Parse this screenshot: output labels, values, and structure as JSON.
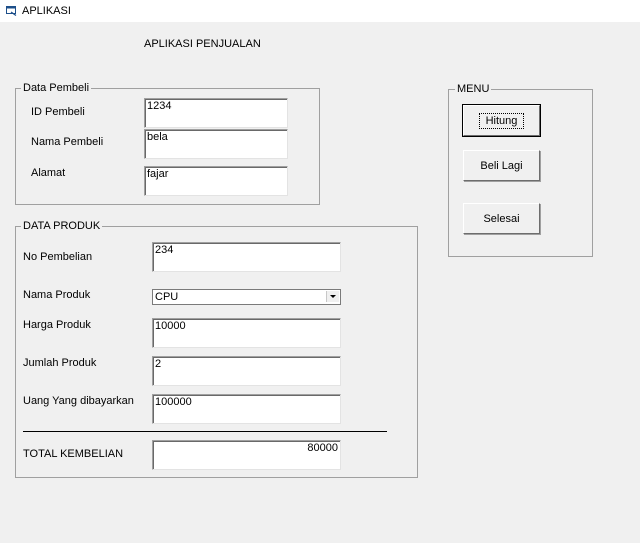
{
  "window": {
    "title": "APLIKASI"
  },
  "heading": "APLIKASI PENJUALAN",
  "data_pembeli": {
    "legend": "Data Pembeli",
    "id_label": "ID Pembeli",
    "id_value": "1234",
    "nama_label": "Nama Pembeli",
    "nama_value": "bela",
    "alamat_label": "Alamat",
    "alamat_value": "fajar"
  },
  "data_produk": {
    "legend": "DATA PRODUK",
    "no_label": "No Pembelian",
    "no_value": "234",
    "produk_label": "Nama Produk",
    "produk_value": "CPU",
    "harga_label": "Harga Produk",
    "harga_value": "10000",
    "jumlah_label": "Jumlah Produk",
    "jumlah_value": "2",
    "uang_label": "Uang Yang dibayarkan",
    "uang_value": "100000",
    "total_label": "TOTAL KEMBELIAN",
    "total_value": "80000"
  },
  "menu": {
    "legend": "MENU",
    "hitung": "Hitung",
    "beli_lagi": "Beli Lagi",
    "selesai": "Selesai"
  },
  "icons": {
    "app": "app-window-icon",
    "dropdown": "chevron-down-icon"
  }
}
